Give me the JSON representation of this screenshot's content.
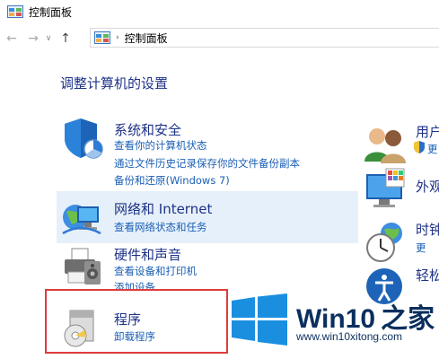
{
  "window": {
    "title": "控制面板"
  },
  "address": {
    "path": "控制面板"
  },
  "heading": "调整计算机的设置",
  "categories_left": [
    {
      "title": "系统和安全",
      "links": [
        "查看你的计算机状态",
        "通过文件历史记录保存你的文件备份副本",
        "备份和还原(Windows 7)"
      ]
    },
    {
      "title": "网络和 Internet",
      "links": [
        "查看网络状态和任务"
      ]
    },
    {
      "title": "硬件和声音",
      "links": [
        "查看设备和打印机",
        "添加设备"
      ]
    },
    {
      "title": "程序",
      "links": [
        "卸载程序"
      ]
    }
  ],
  "categories_right": [
    {
      "title": "用户",
      "links": [
        "更"
      ]
    },
    {
      "title": "外观",
      "links": []
    },
    {
      "title": "时钟",
      "links": [
        "更"
      ]
    },
    {
      "title": "轻松",
      "links": []
    }
  ],
  "watermark": {
    "brand": "Win10",
    "suffix": "之家",
    "url": "www.win10xitong.com"
  },
  "colors": {
    "title_blue": "#1e3287",
    "link_blue": "#1a5fb4",
    "highlight": "#e6f0fa",
    "red_box": "#e03a3a",
    "watermark": "#0b2f5e"
  }
}
